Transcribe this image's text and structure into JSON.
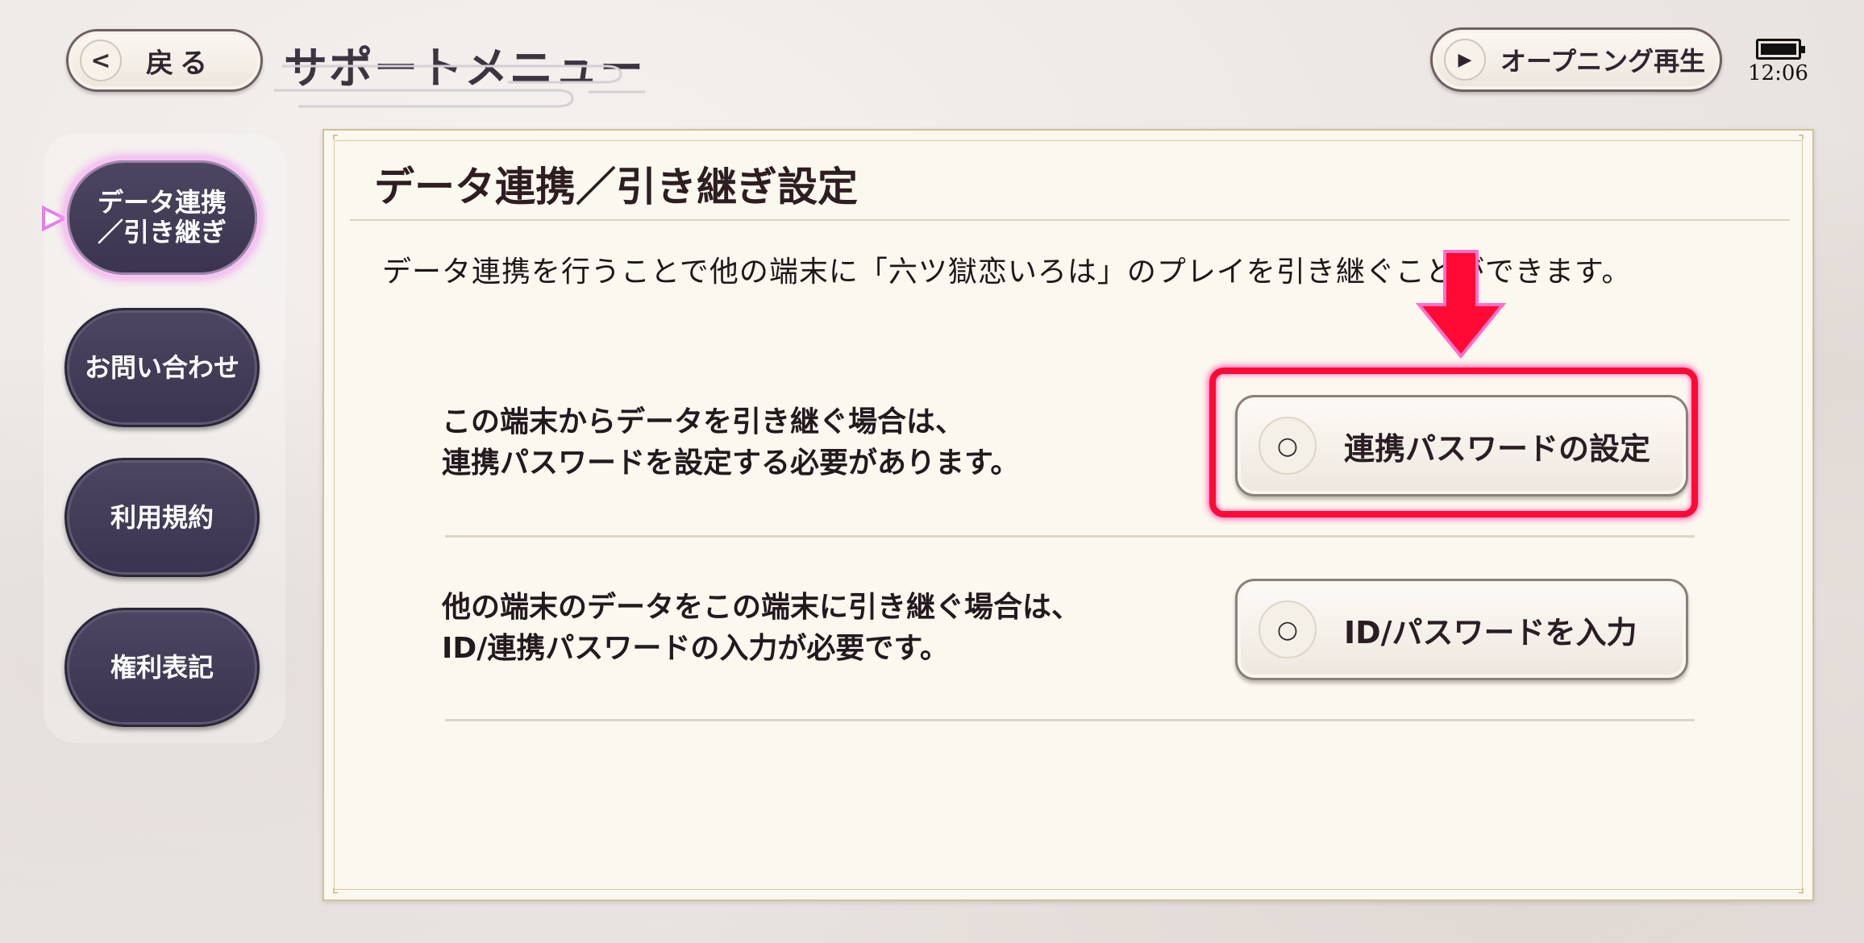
{
  "header": {
    "back_label": "戻る",
    "back_icon": "chevron-left-icon",
    "title": "サポートメニュー",
    "opening_label": "オープニング再生",
    "opening_icon": "play-icon",
    "time": "12:06"
  },
  "sidebar": {
    "items": [
      {
        "label": "データ連携\n／引き継ぎ",
        "active": true
      },
      {
        "label": "お問い合わせ",
        "active": false
      },
      {
        "label": "利用規約",
        "active": false
      },
      {
        "label": "権利表記",
        "active": false
      }
    ]
  },
  "panel": {
    "title": "データ連携／引き継ぎ設定",
    "description": "データ連携を行うことで他の端末に「六ツ獄恋いろは」のプレイを引き継ぐことができます。",
    "rows": [
      {
        "text_line1": "この端末からデータを引き継ぐ場合は、",
        "text_line2": "連携パスワードを設定する必要があります。",
        "button_label": "連携パスワードの設定",
        "button_icon": "○"
      },
      {
        "text_line1": "他の端末のデータをこの端末に引き継ぐ場合は、",
        "text_line2": "ID/連携パスワードの入力が必要です。",
        "button_label": "ID/パスワードを入力",
        "button_icon": "○"
      }
    ]
  },
  "colors": {
    "highlight": "#ff0a35",
    "nav_bg": "#433d58",
    "panel_bg": "#fbf8ef",
    "active_glow": "#f5a0f0"
  }
}
